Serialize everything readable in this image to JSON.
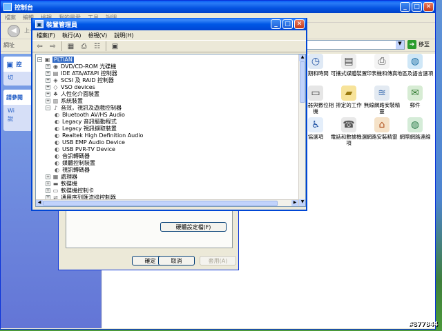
{
  "control_panel": {
    "title": "控制台",
    "menu": [
      "檔案",
      "編輯",
      "檢視",
      "我的最愛",
      "工具",
      "說明"
    ],
    "toolbar_back": "上一",
    "address_label": "網址",
    "go_label": "移至",
    "sidebar": {
      "panel1_title": "控",
      "panel1_item": "切",
      "panel2_title": "請參閱",
      "panel2_items": [
        "Wi",
        "說"
      ]
    },
    "icons": [
      {
        "label": "日期和時間",
        "icon": "clock-icon"
      },
      {
        "label": "可攜式媒體裝置",
        "icon": "media-device-icon"
      },
      {
        "label": "印表機和傳真",
        "icon": "printer-icon"
      },
      {
        "label": "地區及語言選項",
        "icon": "globe-icon"
      },
      {
        "label": "掃描器與數位相機",
        "icon": "scanner-icon"
      },
      {
        "label": "排定的工作",
        "icon": "tasks-folder-icon"
      },
      {
        "label": "無線網路安裝精靈",
        "icon": "wireless-icon"
      },
      {
        "label": "郵件",
        "icon": "mail-icon"
      },
      {
        "label": "協選項",
        "icon": "accessibility-icon"
      },
      {
        "label": "電話和數據機選項",
        "icon": "phone-icon"
      },
      {
        "label": "網路安裝精靈",
        "icon": "network-setup-icon"
      },
      {
        "label": "網際網路連線",
        "icon": "internet-icon"
      }
    ]
  },
  "properties_dialog": {
    "hardware_profile_button": "硬體設定檔(F)",
    "ok_button": "確定",
    "cancel_button": "取消",
    "apply_button": "套用(A)"
  },
  "device_manager": {
    "title": "裝置管理員",
    "menu": [
      "檔案(F)",
      "執行(A)",
      "檢視(V)",
      "說明(H)"
    ],
    "tree": [
      {
        "label": "PLTIAN",
        "level": 0,
        "expander": "−",
        "icon": "computer-icon",
        "selected": true
      },
      {
        "label": "DVD/CD-ROM 光碟機",
        "level": 1,
        "expander": "+",
        "icon": "dvd-drive-icon"
      },
      {
        "label": "IDE ATA/ATAPI 控制器",
        "level": 1,
        "expander": "+",
        "icon": "ide-controller-icon"
      },
      {
        "label": "SCSI 及 RAID 控制器",
        "level": 1,
        "expander": "+",
        "icon": "scsi-controller-icon"
      },
      {
        "label": "VSO devices",
        "level": 1,
        "expander": "+",
        "icon": "vso-device-icon"
      },
      {
        "label": "人性化介面裝置",
        "level": 1,
        "expander": "+",
        "icon": "hid-icon"
      },
      {
        "label": "系統裝置",
        "level": 1,
        "expander": "+",
        "icon": "system-device-icon"
      },
      {
        "label": "音效，視訊及遊戲控制器",
        "level": 1,
        "expander": "−",
        "icon": "sound-icon"
      },
      {
        "label": "Bluetooth AV/HS Audio",
        "level": 2,
        "icon": "audio-device-icon"
      },
      {
        "label": "Legacy 音訊驅動程式",
        "level": 2,
        "icon": "audio-device-icon"
      },
      {
        "label": "Legacy 視訊擷取裝置",
        "level": 2,
        "icon": "audio-device-icon"
      },
      {
        "label": "Realtek High Definition Audio",
        "level": 2,
        "icon": "audio-device-icon"
      },
      {
        "label": "USB EMP Audio Device",
        "level": 2,
        "icon": "audio-device-icon"
      },
      {
        "label": "USB PVR-TV Device",
        "level": 2,
        "icon": "audio-device-icon"
      },
      {
        "label": "音訊轉碼器",
        "level": 2,
        "icon": "audio-device-icon"
      },
      {
        "label": "媒體控制裝置",
        "level": 2,
        "icon": "audio-device-icon"
      },
      {
        "label": "視訊轉碼器",
        "level": 2,
        "icon": "audio-device-icon"
      },
      {
        "label": "處理器",
        "level": 1,
        "expander": "+",
        "icon": "processor-icon"
      },
      {
        "label": "軟碟機",
        "level": 1,
        "expander": "+",
        "icon": "floppy-drive-icon"
      },
      {
        "label": "軟碟機控制卡",
        "level": 1,
        "expander": "+",
        "icon": "floppy-controller-icon"
      },
      {
        "label": "通用序列匯流排控制器",
        "level": 1,
        "expander": "+",
        "icon": "usb-icon"
      }
    ]
  },
  "watermark": "#877844"
}
